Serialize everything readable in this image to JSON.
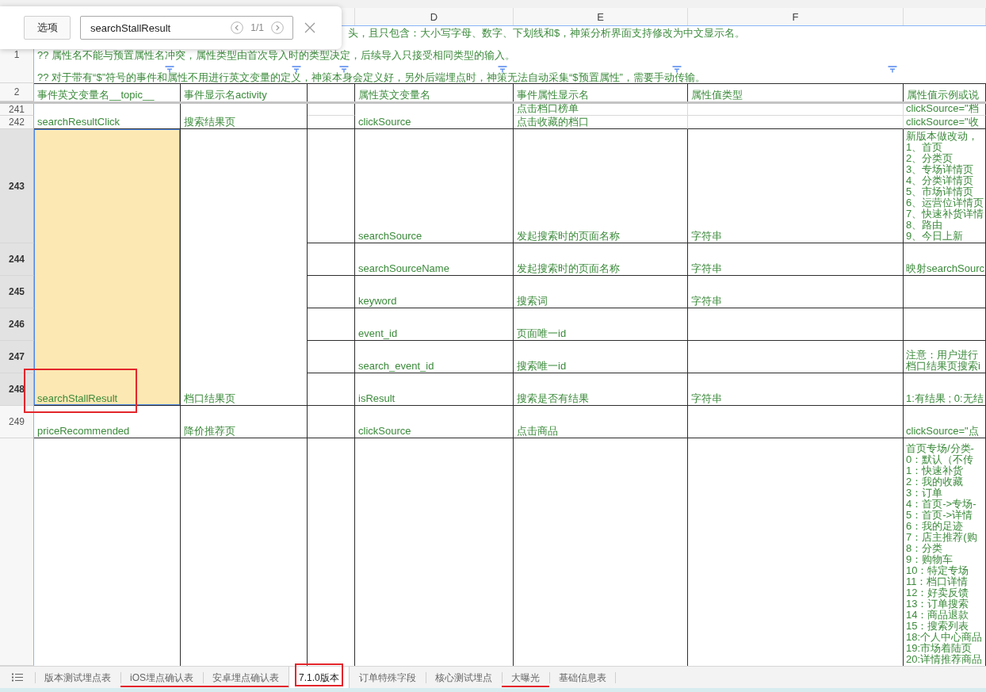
{
  "find_bar": {
    "options_button": "选项",
    "query": "searchStallResult",
    "match_count": "1/1"
  },
  "column_letters": [
    "D",
    "E",
    "F"
  ],
  "notes": {
    "row_number": "1",
    "lines": [
      "头，且只包含：大小写字母、数字、下划线和$，神策分析界面支持修改为中文显示名。",
      "?? 属性名不能与预置属性名冲突，属性类型由首次导入时的类型决定，后续导入只接受相同类型的输入。",
      "?? 对于带有“$”符号的事件和属性不用进行英文变量的定义，神策本身会定义好，另外后端埋点时，神策无法自动采集“$预置属性”，需要手动传输。"
    ]
  },
  "header_row": {
    "row_number": "2",
    "columns": [
      {
        "title": "事件英文变量名__topic__",
        "filter": true
      },
      {
        "title": "事件显示名activity",
        "filter": true
      },
      {
        "filter": true
      },
      {
        "title": "属性英文变量名",
        "filter": true
      },
      {
        "title": "事件属性显示名",
        "filter": true
      },
      {
        "title": "属性值类型",
        "filter": true
      },
      {
        "title": "属性值示例或说",
        "filter": false
      }
    ]
  },
  "events": [
    {
      "name": "searchResultClick",
      "activity": "搜索结果页",
      "selected": false,
      "found": false,
      "boxed": false,
      "properties": [
        {
          "name": "clickSource",
          "rows": [
            {
              "row_number": "241",
              "selected": false,
              "display_name": "点击档口榜单",
              "example": [
                "clickSource=\"档"
              ]
            },
            {
              "row_number": "242",
              "selected": false,
              "display_name": "点击收藏的档口",
              "example": [
                "clickSource=\"收"
              ]
            }
          ]
        }
      ]
    },
    {
      "name": "searchStallResult",
      "activity": "档口结果页",
      "selected": true,
      "found": true,
      "boxed": true,
      "properties": [
        {
          "name": "searchSource",
          "rows": [
            {
              "row_number": "243",
              "selected": true,
              "display_name": "发起搜索时的页面名称",
              "type": "字符串",
              "example": [
                "新版本做改动，",
                "1、首页",
                "2、分类页",
                "3、专场详情页",
                "4、分类详情页",
                "5、市场详情页",
                "6、运营位详情页",
                "7、快速补货详情",
                "8、路由",
                "9、今日上新"
              ]
            }
          ]
        },
        {
          "name": "searchSourceName",
          "rows": [
            {
              "row_number": "244",
              "selected": true,
              "display_name": "发起搜索时的页面名称",
              "type": "字符串",
              "example": [
                "映射searchSourc"
              ]
            }
          ]
        },
        {
          "name": "keyword",
          "rows": [
            {
              "row_number": "245",
              "selected": true,
              "display_name": "搜索词",
              "type": "字符串"
            }
          ]
        },
        {
          "name": "event_id",
          "rows": [
            {
              "row_number": "246",
              "selected": true,
              "display_name": "页面唯一id"
            }
          ]
        },
        {
          "name": "search_event_id",
          "rows": [
            {
              "row_number": "247",
              "selected": true,
              "display_name": "搜索唯一id",
              "example": [
                "注意：用户进行",
                "档口结果页搜索i"
              ]
            }
          ]
        },
        {
          "name": "isResult",
          "rows": [
            {
              "row_number": "248",
              "selected": true,
              "display_name": "搜索是否有结果",
              "type": "字符串",
              "example": [
                "1:有结果 ; 0:无结"
              ]
            }
          ]
        }
      ]
    },
    {
      "name": "priceRecommended",
      "activity": "降价推荐页",
      "selected": false,
      "found": false,
      "boxed": false,
      "properties": [
        {
          "name": "clickSource",
          "rows": [
            {
              "row_number": "249",
              "selected": false,
              "display_name": "点击商品",
              "example": [
                "clickSource=\"点"
              ]
            }
          ]
        }
      ]
    },
    {
      "selected": false,
      "found": false,
      "boxed": false,
      "properties": [
        {
          "rows": [
            {
              "selected": false,
              "example": [
                "首页专场/分类-",
                "0：默认（不传",
                "1：快速补货",
                "2：我的收藏",
                "3：订单",
                "4：首页->专场-",
                "5：首页->详情",
                "6：我的足迹",
                "7：店主推荐(购",
                "8：分类",
                "9：购物车",
                "10：特定专场",
                "11：档口详情",
                "12：好卖反馈",
                "13：订单搜索",
                "14：商品退款",
                "15：搜索列表",
                "18:个人中心商品",
                "19:市场着陆页",
                "20:详情推荐商品"
              ]
            }
          ]
        }
      ]
    }
  ],
  "tabs": [
    {
      "label": "版本测试埋点表",
      "selected": false,
      "underlined": false,
      "boxed": false
    },
    {
      "label": "iOS埋点确认表",
      "selected": false,
      "underlined": true,
      "boxed": false
    },
    {
      "label": "安卓埋点确认表",
      "selected": false,
      "underlined": true,
      "boxed": false
    },
    {
      "label": "7.1.0版本",
      "selected": true,
      "underlined": false,
      "boxed": true
    },
    {
      "label": "订单特殊字段",
      "selected": false,
      "underlined": false,
      "boxed": false
    },
    {
      "label": "核心测试埋点",
      "selected": false,
      "underlined": false,
      "boxed": false
    },
    {
      "label": "大曝光",
      "selected": false,
      "underlined": true,
      "boxed": false
    },
    {
      "label": "基础信息表",
      "selected": false,
      "underlined": false,
      "boxed": false
    }
  ]
}
